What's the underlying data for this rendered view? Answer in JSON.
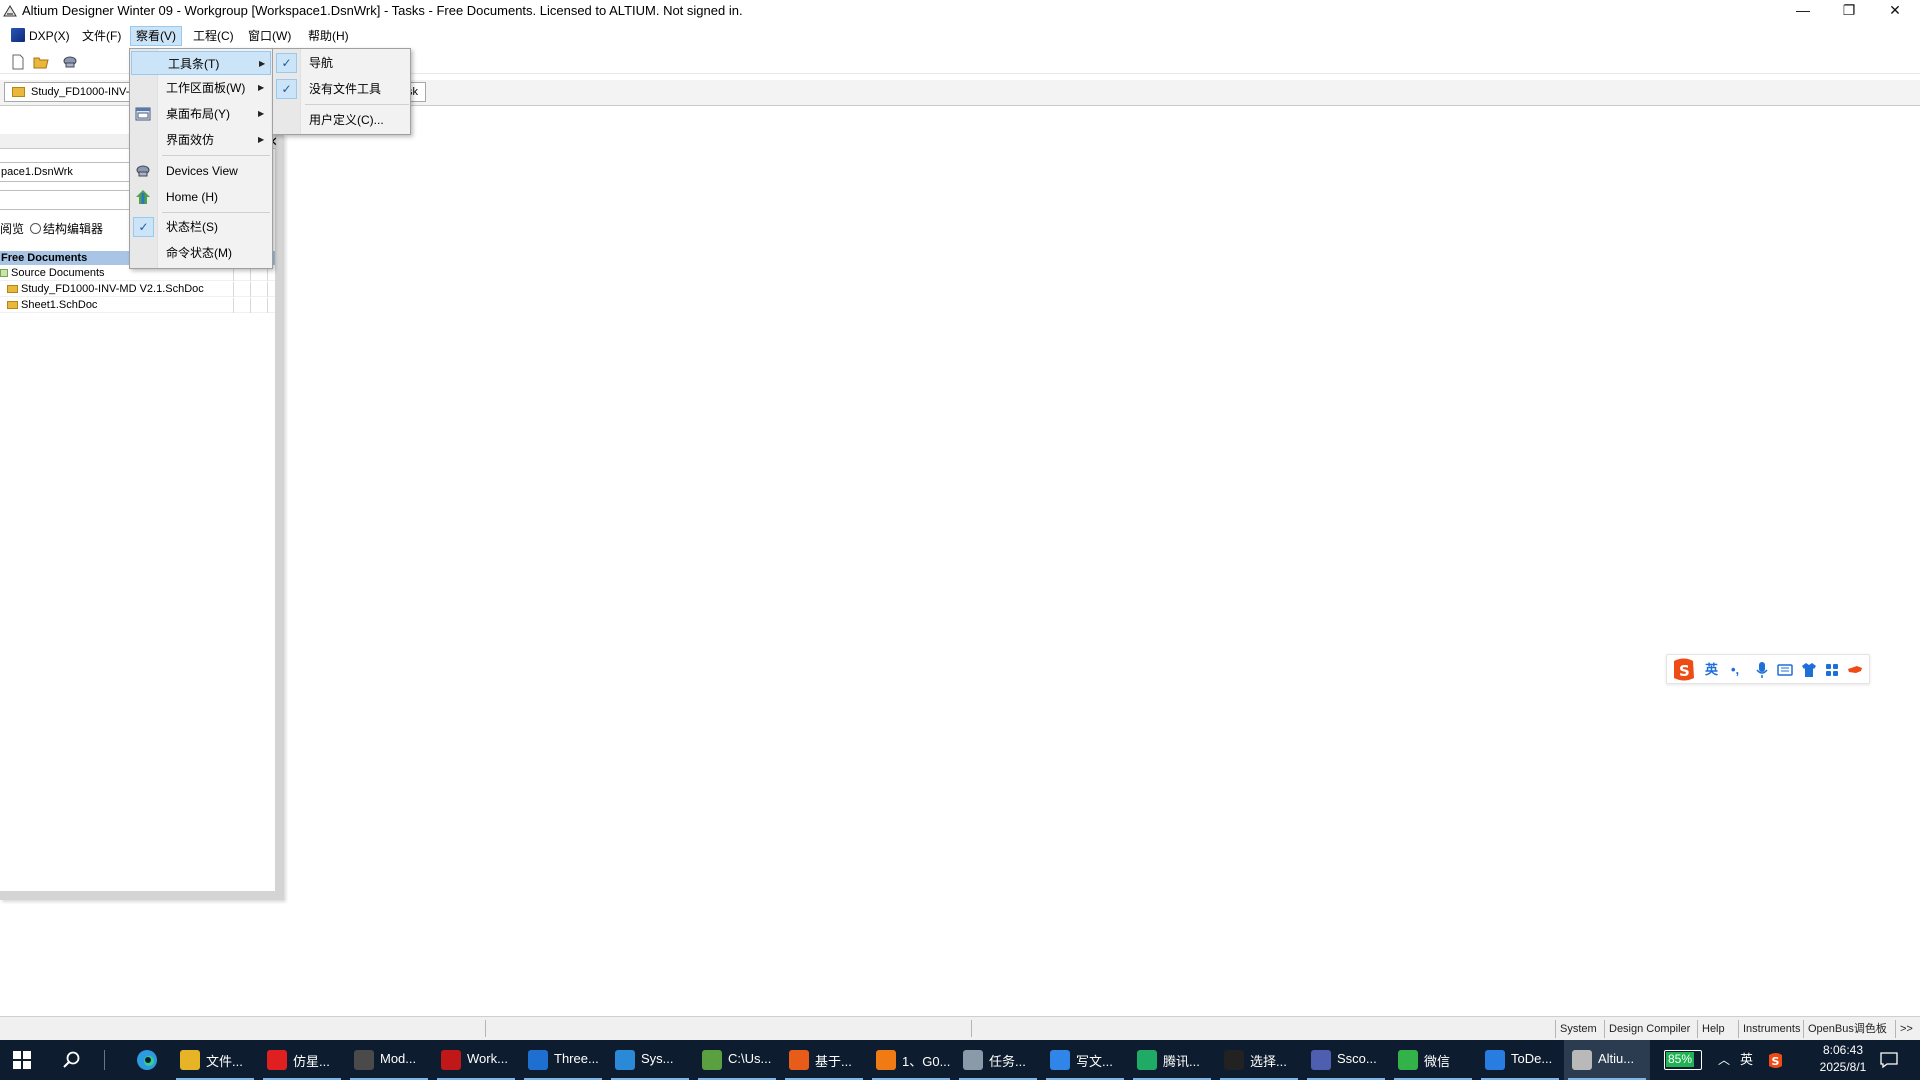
{
  "window": {
    "title": "Altium Designer Winter 09 - Workgroup [Workspace1.DsnWrk] - Tasks - Free Documents. Licensed to ALTIUM. Not signed in.",
    "minimize": "—",
    "restore": "❐",
    "close": "✕"
  },
  "menubar": {
    "items": [
      "DXP(X)",
      "文件(F)",
      "察看(V)",
      "工程(C)",
      "窗口(W)",
      "帮助(H)"
    ],
    "active": "察看(V)"
  },
  "tabs": {
    "doc1": "Study_FD1000-INV-M",
    "doc2_tail": "sk"
  },
  "panel": {
    "close": "✕",
    "workspace": "pace1.DsnWrk",
    "radio_label_left": "阅览",
    "radio_label_right": "结构编辑器",
    "tree_header": "Free Documents",
    "tree": [
      {
        "label": "Source Documents",
        "kind": "group"
      },
      {
        "label": "Study_FD1000-INV-MD V2.1.SchDoc",
        "kind": "doc"
      },
      {
        "label": "Sheet1.SchDoc",
        "kind": "doc"
      }
    ]
  },
  "view_menu": {
    "items": [
      {
        "label": "工具条(T)",
        "submenu": true,
        "highlighted": true
      },
      {
        "label": "工作区面板(W)",
        "submenu": true
      },
      {
        "label": "桌面布局(Y)",
        "submenu": true,
        "icon": "layout-icon"
      },
      {
        "label": "界面效仿",
        "submenu": true
      },
      {
        "label": "Devices View",
        "icon": "devices-view-icon"
      },
      {
        "label": "Home (H)",
        "icon": "home-icon"
      },
      {
        "label": "状态栏(S)",
        "checked": true
      },
      {
        "label": "命令状态(M)"
      }
    ]
  },
  "toolbar_submenu": {
    "items": [
      {
        "label": "导航",
        "checked": true
      },
      {
        "label": "没有文件工具",
        "checked": true
      },
      {
        "label": "用户定义(C)..."
      }
    ]
  },
  "ime": {
    "lang": "英",
    "punct": "•,",
    "icons": [
      "mic-icon",
      "keyboard-icon",
      "shirt-icon",
      "grid-icon",
      "tool-icon"
    ]
  },
  "statusbar": {
    "buttons": [
      "System",
      "Design Compiler",
      "Help",
      "Instruments",
      "OpenBus调色板",
      ">>"
    ]
  },
  "taskbar": {
    "items": [
      {
        "label": "文件...",
        "color": "#e8b427"
      },
      {
        "label": "仿星...",
        "color": "#e02020"
      },
      {
        "label": "Mod...",
        "color": "#4a4a4a"
      },
      {
        "label": "Work...",
        "color": "#c01818"
      },
      {
        "label": "Three...",
        "color": "#1f6fd0"
      },
      {
        "label": "Sys...",
        "color": "#2a8ad8"
      },
      {
        "label": "C:\\Us...",
        "color": "#5aa040"
      },
      {
        "label": "基于...",
        "color": "#e85c1a"
      },
      {
        "label": "1、G0...",
        "color": "#f07a14"
      },
      {
        "label": "任务...",
        "color": "#8a9aa8"
      },
      {
        "label": "写文...",
        "color": "#2f86e8"
      },
      {
        "label": "腾讯...",
        "color": "#1faa66"
      },
      {
        "label": "选择...",
        "color": "#222222"
      },
      {
        "label": "Ssco...",
        "color": "#4f5fb0"
      },
      {
        "label": "微信",
        "color": "#33b24a"
      },
      {
        "label": "ToDe...",
        "color": "#2a7de0"
      },
      {
        "label": "Altiu...",
        "color": "#b9b9b9",
        "active": true
      }
    ],
    "battery": "85%",
    "lang": "英",
    "time": "8:06:43",
    "date": "2025/8/1"
  }
}
